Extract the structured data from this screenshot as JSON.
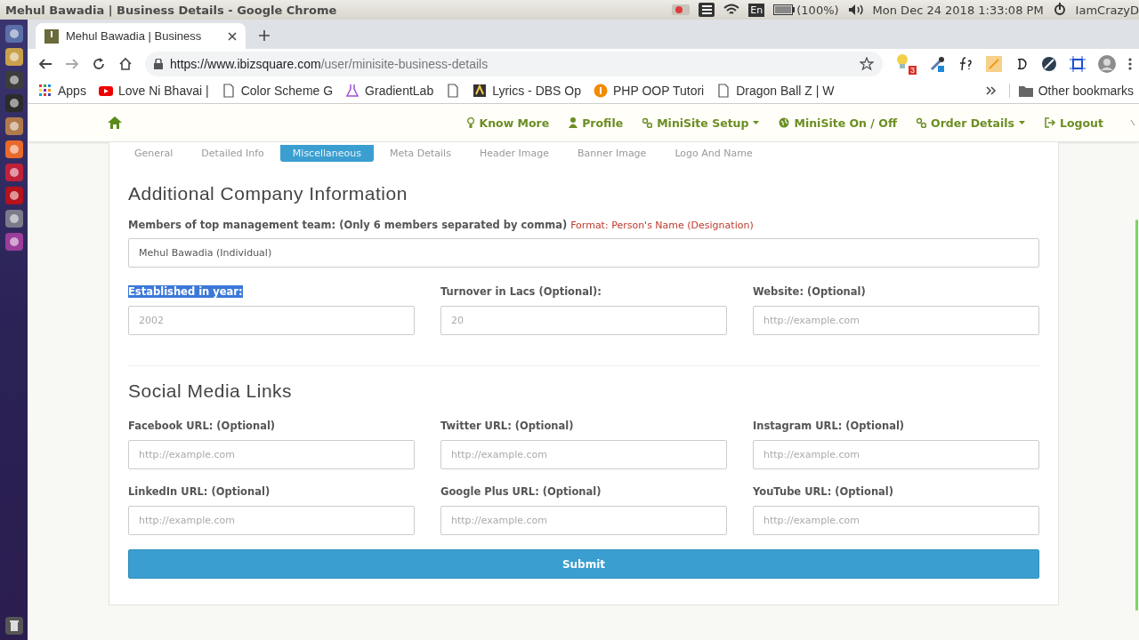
{
  "system_bar": {
    "window_title": "Mehul Bawadia | Business Details - Google Chrome",
    "keyboard": "En",
    "battery": "(100%)",
    "clock": "Mon Dec 24 2018  1:33:08 PM",
    "user": "IamCrazyD"
  },
  "browser": {
    "tab_title": "Mehul Bawadia | Business",
    "url_host": "https://www.ibizsquare.com",
    "url_path": "/user/minisite-business-details",
    "extension_badge": "3",
    "bookmarks": [
      {
        "label": "Apps",
        "kind": "apps"
      },
      {
        "label": "Love Ni Bhavai |",
        "kind": "video"
      },
      {
        "label": "Color Scheme G",
        "kind": "page"
      },
      {
        "label": "GradientLab",
        "kind": "flask"
      },
      {
        "kind": "page"
      },
      {
        "label": "Lyrics - DBS Op",
        "kind": "lyrics"
      },
      {
        "label": "PHP OOP Tutori",
        "kind": "info"
      },
      {
        "label": "Dragon Ball Z | W",
        "kind": "page"
      }
    ],
    "other_bookmarks": "Other bookmarks"
  },
  "navbar": {
    "items": [
      {
        "label": "Know More",
        "kind": "bulb",
        "dropdown": false
      },
      {
        "label": "Profile",
        "kind": "user",
        "dropdown": false
      },
      {
        "label": "MiniSite Setup",
        "kind": "link",
        "dropdown": true
      },
      {
        "label": "MiniSite On / Off",
        "kind": "globe",
        "dropdown": false
      },
      {
        "label": "Order Details",
        "kind": "link",
        "dropdown": true
      },
      {
        "label": "Logout",
        "kind": "logout",
        "dropdown": false
      }
    ]
  },
  "form_tabs": [
    {
      "label": "General",
      "selected": false
    },
    {
      "label": "Detailed Info",
      "selected": false
    },
    {
      "label": "Miscellaneous",
      "selected": true
    },
    {
      "label": "Meta Details",
      "selected": false
    },
    {
      "label": "Header Image",
      "selected": false
    },
    {
      "label": "Banner Image",
      "selected": false
    },
    {
      "label": "Logo And Name",
      "selected": false
    }
  ],
  "company_section": {
    "title": "Additional Company Information",
    "management_label": "Members of top management team: (Only 6 members separated by comma)",
    "management_hint": "Format: Person's Name (Designation)",
    "management_value": "Mehul Bawadia (Individual)",
    "fields": [
      {
        "label": "Established in year:",
        "placeholder": "2002",
        "text_selected": true
      },
      {
        "label": "Turnover in Lacs (Optional):",
        "placeholder": "20",
        "text_selected": false
      },
      {
        "label": "Website: (Optional)",
        "placeholder": "http://example.com",
        "text_selected": false
      }
    ]
  },
  "social_section": {
    "title": "Social Media Links",
    "fields": [
      {
        "label": "Facebook URL: (Optional)",
        "placeholder": "http://example.com"
      },
      {
        "label": "Twitter URL: (Optional)",
        "placeholder": "http://example.com"
      },
      {
        "label": "Instagram URL: (Optional)",
        "placeholder": "http://example.com"
      },
      {
        "label": "LinkedIn URL: (Optional)",
        "placeholder": "http://example.com"
      },
      {
        "label": "Google Plus URL: (Optional)",
        "placeholder": "http://example.com"
      },
      {
        "label": "YouTube URL: (Optional)",
        "placeholder": "http://example.com"
      }
    ]
  },
  "submit_label": "Submit"
}
